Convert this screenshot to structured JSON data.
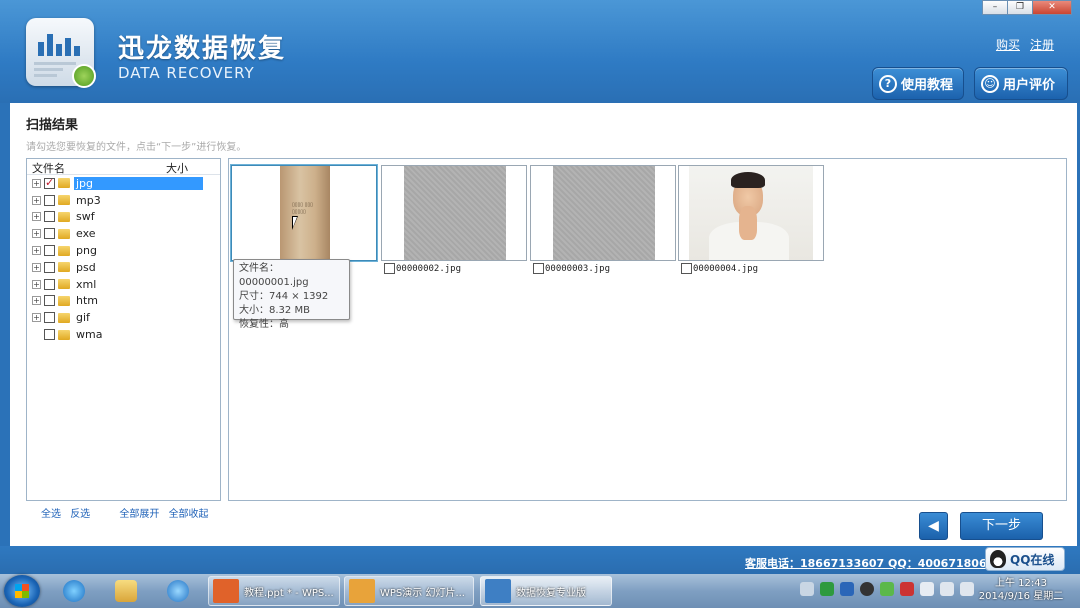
{
  "window": {
    "title": "迅龙数据恢复",
    "subtitle": "DATA RECOVERY",
    "controls": [
      "–",
      "❐",
      "✕"
    ]
  },
  "header": {
    "links": [
      {
        "label": "购买"
      },
      {
        "label": "注册"
      }
    ],
    "tutorial_button": "使用教程",
    "review_button": "用户评价"
  },
  "content": {
    "title": "扫描结果",
    "hint": "请勾选您要恢复的文件，点击“下一步”进行恢复。",
    "tree": {
      "columns": [
        "文件名",
        "大小"
      ],
      "items": [
        {
          "label": "jpg",
          "checked": true,
          "selected": true,
          "expandable": true
        },
        {
          "label": "mp3",
          "checked": false,
          "selected": false,
          "expandable": true
        },
        {
          "label": "swf",
          "checked": false,
          "selected": false,
          "expandable": true
        },
        {
          "label": "exe",
          "checked": false,
          "selected": false,
          "expandable": true
        },
        {
          "label": "png",
          "checked": false,
          "selected": false,
          "expandable": true
        },
        {
          "label": "psd",
          "checked": false,
          "selected": false,
          "expandable": true
        },
        {
          "label": "xml",
          "checked": false,
          "selected": false,
          "expandable": true
        },
        {
          "label": "htm",
          "checked": false,
          "selected": false,
          "expandable": true
        },
        {
          "label": "gif",
          "checked": false,
          "selected": false,
          "expandable": true
        },
        {
          "label": "wma",
          "checked": false,
          "selected": false,
          "expandable": false
        }
      ],
      "links": {
        "select_all": "全选",
        "invert": "反选",
        "expand_all": "全部展开",
        "collapse_all": "全部收起"
      }
    },
    "thumbnails": [
      {
        "filename": "00000001.jpg",
        "active": true
      },
      {
        "filename": "00000002.jpg",
        "active": false
      },
      {
        "filename": "00000003.jpg",
        "active": false
      },
      {
        "filename": "00000004.jpg",
        "active": false
      }
    ],
    "tooltip": {
      "name_line": "文件名：00000001.jpg",
      "size_line": "尺寸：744 × 1392",
      "bytes_line": "大小：8.32 MB",
      "recover_line": "恢复性：高"
    },
    "prev_button": "◀",
    "next_button": "下一步"
  },
  "footer": {
    "hotline": "客服电话：18667133607  QQ：4006718068",
    "qq_button": "QQ在线"
  },
  "taskbar": {
    "items": [
      {
        "label": "教程.ppt * - WPS...",
        "color": "#e0622a"
      },
      {
        "label": "WPS演示 幻灯片...",
        "color": "#e8a33a"
      },
      {
        "label": "数据恢复专业版",
        "color": "#3e7fc4"
      }
    ],
    "clock_time": "上午 12:43",
    "clock_date": "2014/9/16 星期二"
  }
}
